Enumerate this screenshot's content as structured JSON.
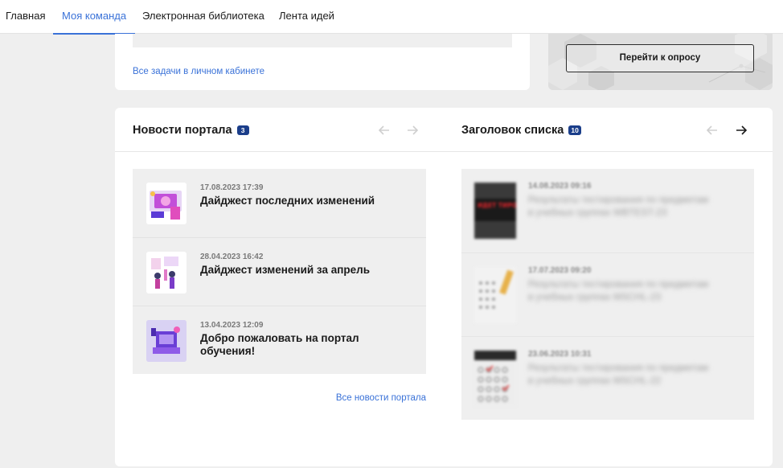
{
  "nav": {
    "tabs": [
      {
        "label": "Главная",
        "active": false
      },
      {
        "label": "Моя команда",
        "active": true
      },
      {
        "label": "Электронная библиотека",
        "active": false
      },
      {
        "label": "Лента идей",
        "active": false
      }
    ]
  },
  "tasks_card": {
    "link": "Все задачи в личном кабинете"
  },
  "survey_card": {
    "button": "Перейти к опросу"
  },
  "news_panel": {
    "title": "Новости портала",
    "count": "3",
    "items": [
      {
        "date": "17.08.2023 17:39",
        "title": "Дайджест последних изменений",
        "icon": "digest-illustration"
      },
      {
        "date": "28.04.2023 16:42",
        "title": "Дайджест изменений за апрель",
        "icon": "team-illustration"
      },
      {
        "date": "13.04.2023 12:09",
        "title": "Добро пожаловать на портал обучения!",
        "icon": "welcome-illustration"
      }
    ],
    "more_link": "Все новости портала"
  },
  "list_panel": {
    "title": "Заголовок списка",
    "count": "10",
    "items": [
      {
        "date": "14.08.2023 09:16",
        "text": "Результаты тестирования по предметам в учебных группах WBTEST-23",
        "icon": "testing-sign-image",
        "sign_text": "ИДЕТ ТИРОВАНИ"
      },
      {
        "date": "17.07.2023 09:20",
        "text": "Результаты тестирования по предметам в учебных группах MSCHL-23",
        "icon": "test-sheet-image"
      },
      {
        "date": "23.06.2023 10:31",
        "text": "Результаты тестирования по предметам в учебных группах MSCHL-22",
        "icon": "answer-sheet-image"
      }
    ]
  },
  "colors": {
    "accent": "#3a72d8",
    "badge": "#1b3e8a",
    "background": "#efefef"
  }
}
